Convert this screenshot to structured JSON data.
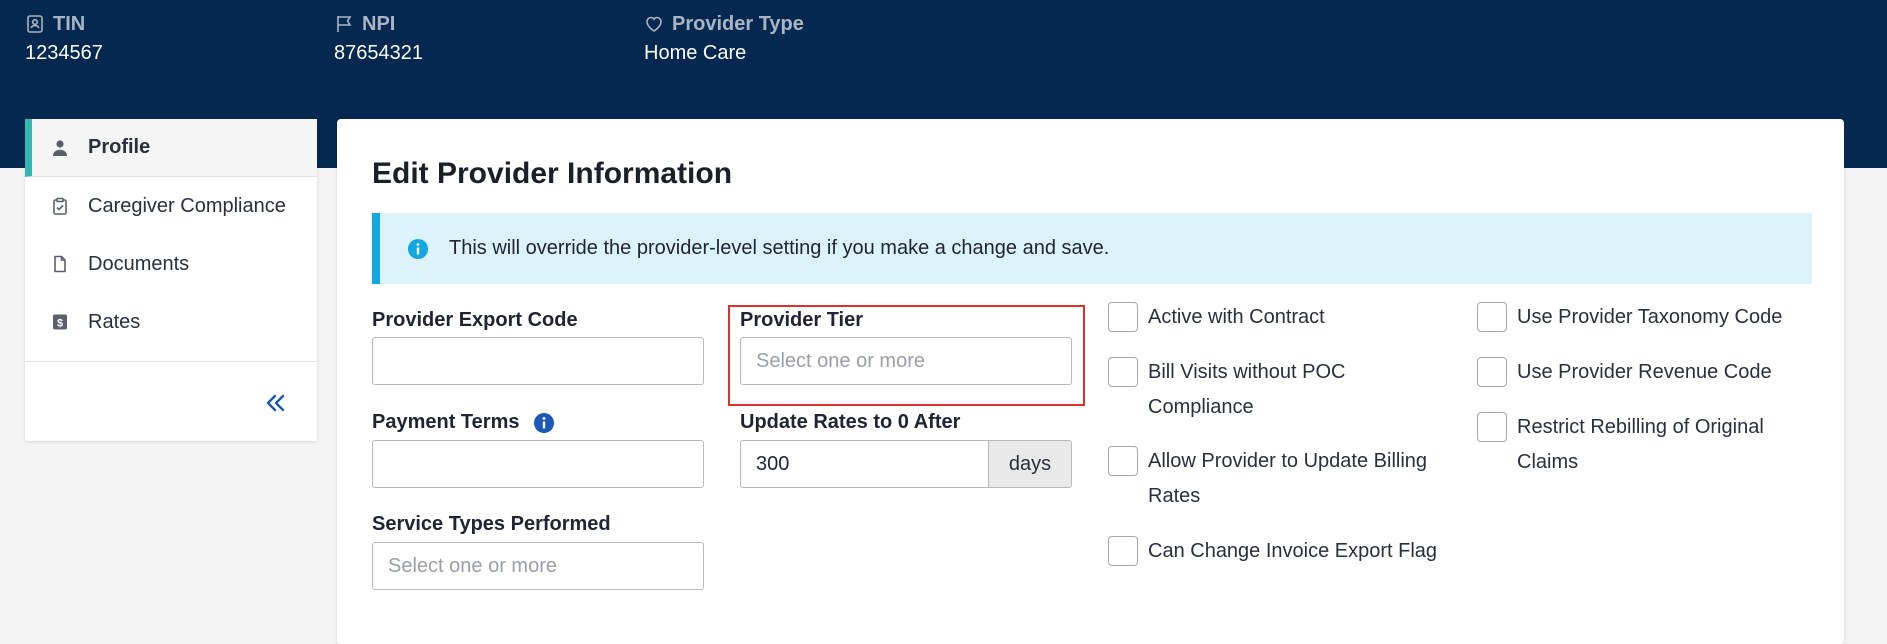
{
  "header": {
    "tin": {
      "label": "TIN",
      "value": "1234567"
    },
    "npi": {
      "label": "NPI",
      "value": "87654321"
    },
    "provider_type": {
      "label": "Provider Type",
      "value": "Home Care"
    }
  },
  "sidebar": {
    "items": [
      {
        "label": "Profile",
        "icon": "person-icon",
        "active": true
      },
      {
        "label": "Caregiver Compliance",
        "icon": "clipboard-check-icon"
      },
      {
        "label": "Documents",
        "icon": "document-icon"
      },
      {
        "label": "Rates",
        "icon": "dollar-icon"
      }
    ],
    "collapse_icon": "double-chevron-left-icon"
  },
  "panel": {
    "title": "Edit Provider Information",
    "alert": "This will override the provider-level setting if you make a change and save."
  },
  "form": {
    "provider_export_code": {
      "label": "Provider Export Code",
      "value": ""
    },
    "provider_tier": {
      "label": "Provider Tier",
      "placeholder": "Select one or more"
    },
    "payment_terms": {
      "label": "Payment Terms",
      "value": ""
    },
    "update_rates": {
      "label": "Update Rates to 0 After",
      "value": "300",
      "unit": "days"
    },
    "service_types": {
      "label": "Service Types Performed",
      "placeholder": "Select one or more"
    }
  },
  "checkboxes": {
    "col1": [
      {
        "label": "Active with Contract",
        "checked": false
      },
      {
        "label": "Bill Visits without POC Compliance",
        "checked": false
      },
      {
        "label": "Allow Provider to Update Billing Rates",
        "checked": false
      },
      {
        "label": "Can Change Invoice Export Flag",
        "checked": false
      }
    ],
    "col2": [
      {
        "label": "Use Provider Taxonomy Code",
        "checked": false
      },
      {
        "label": "Use Provider Revenue Code",
        "checked": false
      },
      {
        "label": "Restrict Rebilling of Original Claims",
        "checked": false
      }
    ]
  },
  "colors": {
    "header_bg": "#04284f",
    "active_accent": "#35b8b0",
    "alert_bg": "#ddf3fb",
    "alert_accent": "#12a7e0",
    "highlight": "#e0302a",
    "info_icon": "#1d57b8"
  }
}
